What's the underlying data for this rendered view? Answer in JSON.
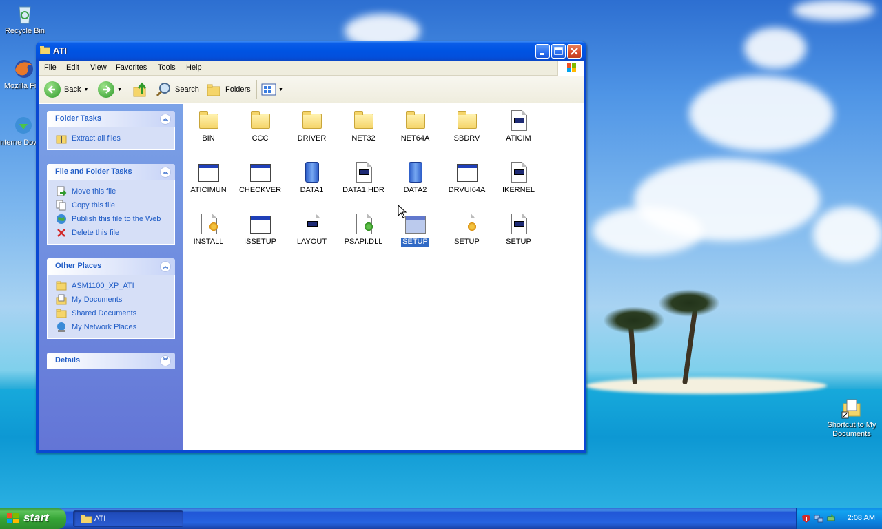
{
  "desktop": {
    "icons": [
      {
        "label": "Recycle Bin",
        "icon": "recycle-bin-icon"
      },
      {
        "label": "Mozilla Fire",
        "icon": "firefox-icon"
      },
      {
        "label": "Interne Downlo",
        "icon": "internet-download-manager-icon"
      },
      {
        "label": "Shortcut to My Documents",
        "icon": "my-documents-shortcut-icon"
      }
    ]
  },
  "window": {
    "title": "ATI",
    "menu": [
      "File",
      "Edit",
      "View",
      "Favorites",
      "Tools",
      "Help"
    ],
    "toolbar": {
      "back_label": "Back",
      "search_label": "Search",
      "folders_label": "Folders"
    },
    "taskpane": {
      "folder_tasks": {
        "title": "Folder Tasks",
        "items": [
          "Extract all files"
        ]
      },
      "file_folder_tasks": {
        "title": "File and Folder Tasks",
        "items": [
          "Move this file",
          "Copy this file",
          "Publish this file to the Web",
          "Delete this file"
        ]
      },
      "other_places": {
        "title": "Other Places",
        "items": [
          "ASM1100_XP_ATI",
          "My Documents",
          "Shared Documents",
          "My Network Places"
        ]
      },
      "details": {
        "title": "Details"
      }
    },
    "files": [
      {
        "name": "BIN",
        "type": "folder"
      },
      {
        "name": "CCC",
        "type": "folder"
      },
      {
        "name": "DRIVER",
        "type": "folder"
      },
      {
        "name": "NET32",
        "type": "folder"
      },
      {
        "name": "NET64A",
        "type": "folder"
      },
      {
        "name": "SBDRV",
        "type": "folder"
      },
      {
        "name": "ATICIM",
        "type": "config"
      },
      {
        "name": "ATICIMUN",
        "type": "app"
      },
      {
        "name": "CHECKVER",
        "type": "app"
      },
      {
        "name": "DATA1",
        "type": "cab"
      },
      {
        "name": "DATA1.HDR",
        "type": "config"
      },
      {
        "name": "DATA2",
        "type": "cab"
      },
      {
        "name": "DRVUI64A",
        "type": "app"
      },
      {
        "name": "IKERNEL",
        "type": "config"
      },
      {
        "name": "INSTALL",
        "type": "setup-info"
      },
      {
        "name": "ISSETUP",
        "type": "app"
      },
      {
        "name": "LAYOUT",
        "type": "config"
      },
      {
        "name": "PSAPI.DLL",
        "type": "dll"
      },
      {
        "name": "SETUP",
        "type": "app",
        "selected": true
      },
      {
        "name": "SETUP",
        "type": "setup-info"
      },
      {
        "name": "SETUP",
        "type": "config"
      }
    ]
  },
  "taskbar": {
    "start_label": "start",
    "task_label": "ATI",
    "clock": "2:08 AM"
  }
}
